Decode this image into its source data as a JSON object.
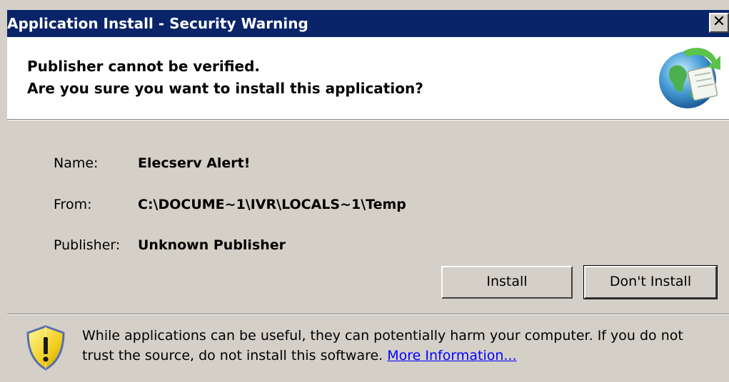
{
  "window": {
    "title": "Application Install - Security Warning",
    "close_label": "✕"
  },
  "header": {
    "line1": "Publisher cannot be verified.",
    "line2": "Are you sure you want to install this application?",
    "icon": "globe-install-icon"
  },
  "details": {
    "name_label": "Name:",
    "name_value": "Elecserv Alert!",
    "from_label": "From:",
    "from_value": "C:\\DOCUME~1\\IVR\\LOCALS~1\\Temp",
    "publisher_label": "Publisher:",
    "publisher_value": "Unknown Publisher"
  },
  "buttons": {
    "install_label": "Install",
    "dont_install_label": "Don't Install"
  },
  "footer": {
    "icon": "warning-shield-icon",
    "warning_text": "While applications can be useful, they can potentially harm your computer. If you do not trust the source, do not install this software. ",
    "link_text": "More Information..."
  },
  "colors": {
    "titlebar": "#0a246a",
    "dialog_bg": "#d4d0c8",
    "link": "#0000ff"
  }
}
